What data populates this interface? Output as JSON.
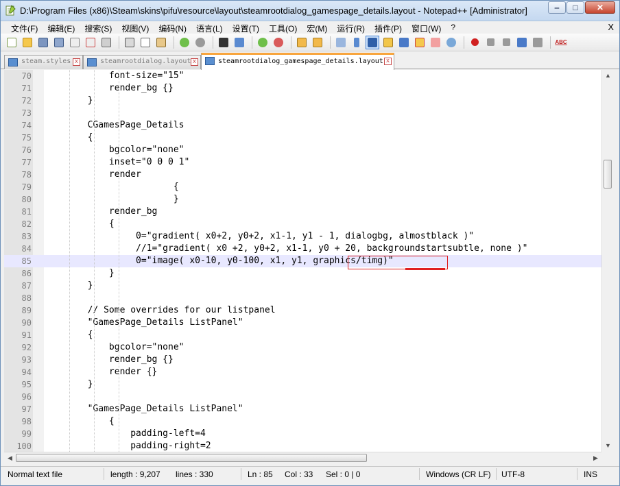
{
  "window": {
    "title": "D:\\Program Files (x86)\\Steam\\skins\\pifu\\resource\\layout\\steamrootdialog_gamespage_details.layout - Notepad++ [Administrator]",
    "minimize": "‒",
    "maximize": "□",
    "close": "✕"
  },
  "menu": [
    "文件(F)",
    "编辑(E)",
    "搜索(S)",
    "视图(V)",
    "编码(N)",
    "语言(L)",
    "设置(T)",
    "工具(O)",
    "宏(M)",
    "运行(R)",
    "插件(P)",
    "窗口(W)",
    "?"
  ],
  "menu_close": "X",
  "toolbar_abc": "ABC",
  "tabs": [
    {
      "label": "steam.styles",
      "active": false
    },
    {
      "label": "steamrootdialog.layout",
      "active": false
    },
    {
      "label": "steamrootdialog_gamespage_details.layout",
      "active": true
    }
  ],
  "tab_close": "x",
  "editor": {
    "lines": [
      {
        "n": "70",
        "t": "            font-size=\"15\""
      },
      {
        "n": "71",
        "t": "            render_bg {}"
      },
      {
        "n": "72",
        "t": "        }"
      },
      {
        "n": "73",
        "t": ""
      },
      {
        "n": "74",
        "t": "        CGamesPage_Details"
      },
      {
        "n": "75",
        "t": "        {"
      },
      {
        "n": "76",
        "t": "            bgcolor=\"none\""
      },
      {
        "n": "77",
        "t": "            inset=\"0 0 0 1\""
      },
      {
        "n": "78",
        "t": "            render"
      },
      {
        "n": "79",
        "t": "                        {"
      },
      {
        "n": "80",
        "t": "                        }"
      },
      {
        "n": "81",
        "t": "            render_bg"
      },
      {
        "n": "82",
        "t": "            {"
      },
      {
        "n": "83",
        "t": "                 0=\"gradient( x0+2, y0+2, x1-1, y1 - 1, dialogbg, almostblack )\""
      },
      {
        "n": "84",
        "t": "                 //1=\"gradient( x0 +2, y0+2, x1-1, y0 + 20, backgroundstartsubtle, none )\""
      },
      {
        "n": "85",
        "t": "                 0=\"image( x0-10, y0-100, x1, y1, graphics/timg)\""
      },
      {
        "n": "86",
        "t": "            }"
      },
      {
        "n": "87",
        "t": "        }"
      },
      {
        "n": "88",
        "t": ""
      },
      {
        "n": "89",
        "t": "        // Some overrides for our listpanel"
      },
      {
        "n": "90",
        "t": "        \"GamesPage_Details ListPanel\""
      },
      {
        "n": "91",
        "t": "        {"
      },
      {
        "n": "92",
        "t": "            bgcolor=\"none\""
      },
      {
        "n": "93",
        "t": "            render_bg {}"
      },
      {
        "n": "94",
        "t": "            render {}"
      },
      {
        "n": "95",
        "t": "        }"
      },
      {
        "n": "96",
        "t": ""
      },
      {
        "n": "97",
        "t": "        \"GamesPage_Details ListPanel\""
      },
      {
        "n": "98",
        "t": "            {"
      },
      {
        "n": "99",
        "t": "                padding-left=4"
      },
      {
        "n": "100",
        "t": "                padding-right=2"
      }
    ],
    "current_line": "85",
    "highlighted_text": "graphics/timg"
  },
  "status": {
    "mode": "Normal text file",
    "length": "length : 9,207",
    "lines": "lines : 330",
    "ln": "Ln : 85",
    "col": "Col : 33",
    "sel": "Sel : 0 | 0",
    "eol": "Windows (CR LF)",
    "encoding": "UTF-8",
    "ins": "INS"
  },
  "colors": {
    "current_line_bg": "#e8e8ff",
    "active_tab_accent": "#f8a53e",
    "annotation_red": "#e02020"
  }
}
